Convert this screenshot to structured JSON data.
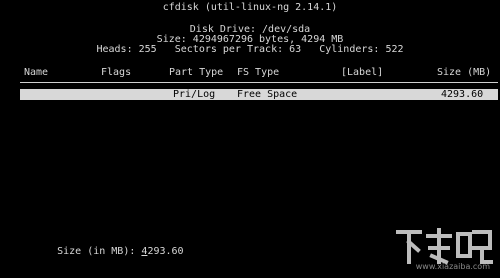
{
  "header": {
    "title": "cfdisk (util-linux-ng 2.14.1)",
    "drive": "Disk Drive: /dev/sda",
    "size": "Size: 4294967296 bytes, 4294 MB",
    "geometry": "Heads: 255   Sectors per Track: 63   Cylinders: 522"
  },
  "table": {
    "columns": {
      "name": "Name",
      "flags": "Flags",
      "part_type": "Part Type",
      "fs_type": "FS Type",
      "label": "[Label]",
      "size": "Size (MB)"
    },
    "rows": [
      {
        "name": "",
        "flags": "",
        "part_type": "Pri/Log",
        "fs_type": "Free Space",
        "label": "",
        "size": "4293.60"
      }
    ]
  },
  "prompt": {
    "label": "Size (in MB):",
    "value_first": "4",
    "value_rest": "293.60"
  },
  "watermark": {
    "url": "www.xiazaiba.com"
  },
  "colors": {
    "background": "#000000",
    "text": "#d8d8d8",
    "highlight": "#d8d8d8"
  }
}
